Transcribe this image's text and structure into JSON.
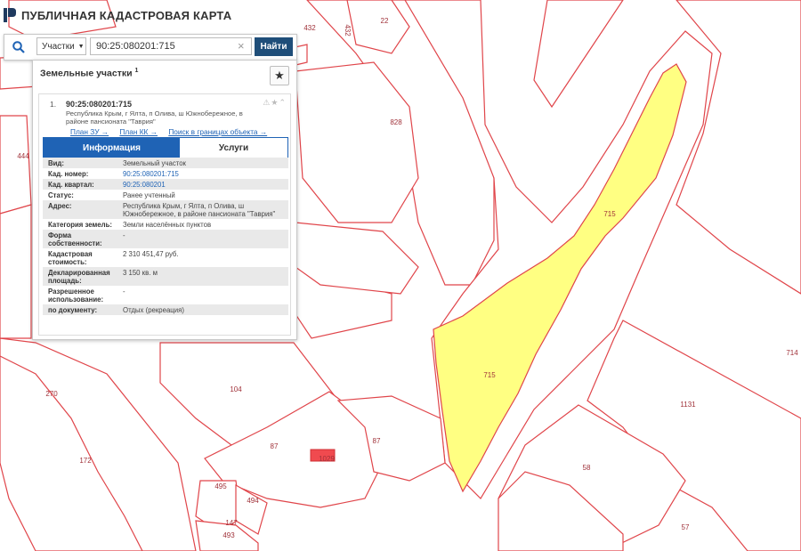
{
  "app": {
    "title": "ПУБЛИЧНАЯ КАДАСТРОВАЯ КАРТА"
  },
  "search": {
    "type_label": "Участки",
    "value": "90:25:080201:715",
    "find_label": "Найти"
  },
  "panel": {
    "title": "Земельные участки",
    "count": "1",
    "item": {
      "index": "1.",
      "cad_number": "90:25:080201:715",
      "address": "Республика Крым, г Ялта, п Олива, ш Южнобережное, в районе пансионата \"Таврия\"",
      "links": [
        "План ЗУ →",
        "План КК →",
        "Поиск в границах объекта →"
      ],
      "tabs": [
        "Информация",
        "Услуги"
      ],
      "info": [
        {
          "k": "Вид:",
          "v": "Земельный участок"
        },
        {
          "k": "Кад. номер:",
          "v": "90:25:080201:715"
        },
        {
          "k": "Кад. квартал:",
          "v": "90:25:080201"
        },
        {
          "k": "Статус:",
          "v": "Ранее учтенный"
        },
        {
          "k": "Адрес:",
          "v": "Республика Крым, г Ялта, п Олива, ш Южнобережное, в районе пансионата \"Таврия\""
        },
        {
          "k": "Категория земель:",
          "v": "Земли населённых пунктов"
        },
        {
          "k": "Форма собственности:",
          "v": "-"
        },
        {
          "k": "Кадастровая стоимость:",
          "v": "2 310 451,47 руб."
        },
        {
          "k": "Декларированная площадь:",
          "v": "3 150 кв. м"
        },
        {
          "k": "Разрешенное использование:",
          "v": "-"
        },
        {
          "k": "по документу:",
          "v": "Отдых (рекреация)"
        }
      ]
    }
  },
  "map": {
    "labels": [
      "432",
      "432",
      "22",
      "828",
      "444",
      "715",
      "715",
      "714",
      "270",
      "104",
      "1131",
      "87",
      "87",
      "172",
      "1029",
      "58",
      "495",
      "494",
      "147",
      "493",
      "57"
    ],
    "colors": {
      "boundary": "#e0454a",
      "selected_fill": "#ffff82",
      "highlight_fill": "#f04a4f"
    }
  }
}
